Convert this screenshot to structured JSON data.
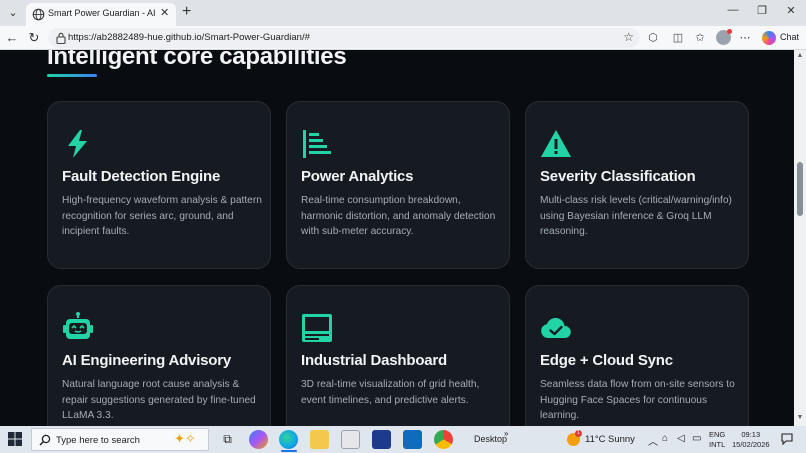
{
  "browser": {
    "tab_title": "Smart Power Guardian - AI fault de",
    "url": "https://ab2882489-hue.github.io/Smart-Power-Guardian/#",
    "chat_label": "Chat"
  },
  "section": {
    "title": "Intelligent core capabilities"
  },
  "cards": [
    {
      "title": "Fault Detection Engine",
      "description": "High-frequency waveform analysis & pattern recognition for series arc, ground, and incipient faults.",
      "icon": "lightning-icon"
    },
    {
      "title": "Power Analytics",
      "description": "Real-time consumption breakdown, harmonic distortion, and anomaly detection with sub-meter accuracy.",
      "icon": "bar-list-icon"
    },
    {
      "title": "Severity Classification",
      "description": "Multi-class risk levels (critical/warning/info) using Bayesian inference & Groq LLM reasoning.",
      "icon": "warning-triangle-icon"
    },
    {
      "title": "AI Engineering Advisory",
      "description": "Natural language root cause analysis & repair suggestions generated by fine-tuned LLaMA 3.3.",
      "icon": "robot-icon"
    },
    {
      "title": "Industrial Dashboard",
      "description": "3D real-time visualization of grid health, event timelines, and predictive alerts.",
      "icon": "monitor-icon"
    },
    {
      "title": "Edge + Cloud Sync",
      "description": "Seamless data flow from on-site sensors to Hugging Face Spaces for continuous learning.",
      "icon": "cloud-check-icon"
    }
  ],
  "taskbar": {
    "search_placeholder": "Type here to search",
    "desktop_label": "Desktop",
    "weather_temp": "11°C",
    "weather_condition": "Sunny",
    "lang_line1": "ENG",
    "lang_line2": "INTL",
    "time": "09:13",
    "date": "15/02/2026"
  },
  "colors": {
    "accent": "#22d3a5",
    "card_bg": "#161b21",
    "page_bg": "#090d11"
  }
}
